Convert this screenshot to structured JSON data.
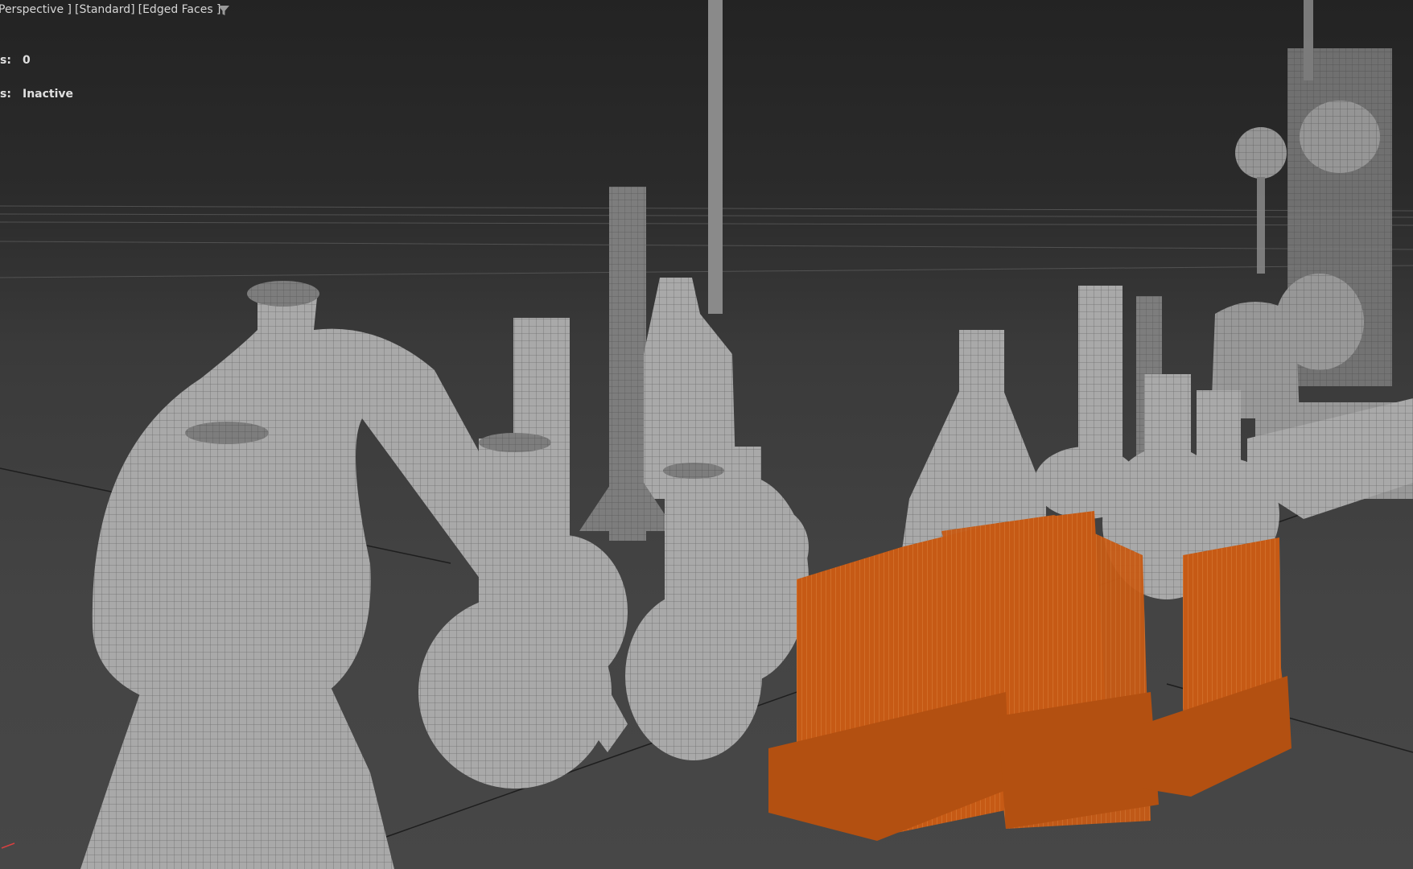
{
  "viewport": {
    "labels": [
      "Perspective ]",
      "[Standard]",
      "[Edged Faces ]"
    ],
    "filter_icon": "funnel-icon",
    "stats": [
      {
        "key": "s:",
        "value": "0"
      },
      {
        "key": "s:",
        "value": "Inactive"
      }
    ],
    "colors": {
      "background_top": "#232323",
      "background_bottom": "#474747",
      "wire_gray": "#b8b8b8",
      "selected_orange": "#c85a14"
    }
  }
}
